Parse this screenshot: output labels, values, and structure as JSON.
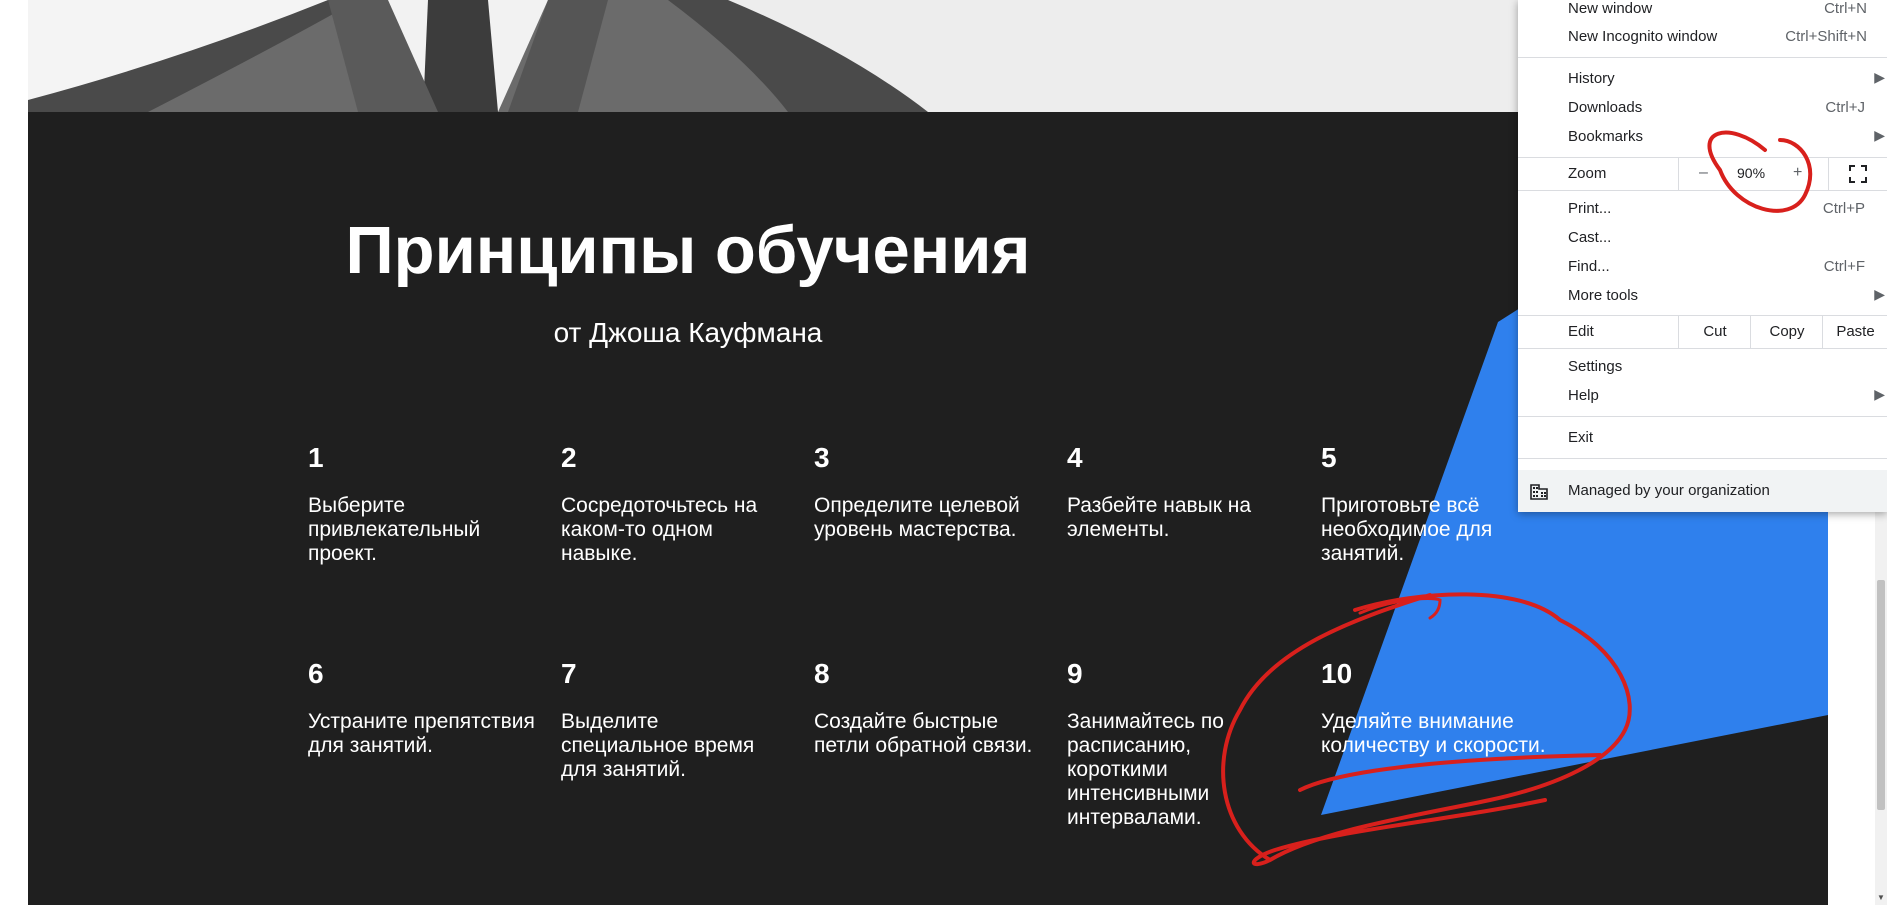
{
  "page": {
    "heading": "Принципы обучения",
    "subheading": "от Джоша Кауфмана",
    "principles": [
      {
        "num": "1",
        "text": "Выберите привлекательный проект."
      },
      {
        "num": "2",
        "text": "Сосредоточьтесь на каком-то одном навыке."
      },
      {
        "num": "3",
        "text": "Определите целевой уровень мастерства."
      },
      {
        "num": "4",
        "text": "Разбейте навык на элементы."
      },
      {
        "num": "5",
        "text": "Приготовьте всё необходимое для занятий."
      },
      {
        "num": "6",
        "text": "Устраните препятствия для занятий."
      },
      {
        "num": "7",
        "text": "Выделите специальное время для занятий."
      },
      {
        "num": "8",
        "text": "Создайте быстрые петли обратной связи."
      },
      {
        "num": "9",
        "text": "Занимайтесь по расписанию, короткими интенсивными интервалами."
      },
      {
        "num": "10",
        "text": "Уделяйте внимание количеству и скорости."
      }
    ]
  },
  "menu": {
    "new_window": {
      "label": "New window",
      "shortcut": "Ctrl+N"
    },
    "new_incognito": {
      "label": "New Incognito window",
      "shortcut": "Ctrl+Shift+N"
    },
    "history": {
      "label": "History"
    },
    "downloads": {
      "label": "Downloads",
      "shortcut": "Ctrl+J"
    },
    "bookmarks": {
      "label": "Bookmarks"
    },
    "zoom": {
      "label": "Zoom",
      "minus": "–",
      "value": "90%",
      "plus": "+"
    },
    "print": {
      "label": "Print...",
      "shortcut": "Ctrl+P"
    },
    "cast": {
      "label": "Cast..."
    },
    "find": {
      "label": "Find...",
      "shortcut": "Ctrl+F"
    },
    "more_tools": {
      "label": "More tools"
    },
    "edit": {
      "label": "Edit",
      "cut": "Cut",
      "copy": "Copy",
      "paste": "Paste"
    },
    "settings": {
      "label": "Settings"
    },
    "help": {
      "label": "Help"
    },
    "exit": {
      "label": "Exit"
    },
    "managed": {
      "label": "Managed by your organization"
    }
  },
  "colors": {
    "dark_bg": "#1f1f1f",
    "accent_blue": "#2f80ed",
    "annotation_red": "#d8201c"
  },
  "icons": [
    "fullscreen-icon",
    "building-icon",
    "submenu-arrow-icon"
  ]
}
